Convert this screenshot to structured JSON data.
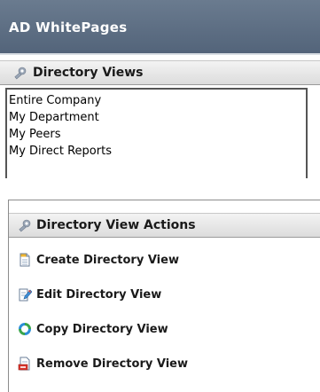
{
  "app": {
    "title": "AD WhitePages"
  },
  "directory_views": {
    "title": "Directory Views",
    "icon": "gear-icon",
    "items": [
      "Entire Company",
      "My Department",
      "My Peers",
      "My Direct Reports"
    ]
  },
  "directory_view_actions": {
    "title": "Directory View Actions",
    "icon": "gear-icon",
    "items": [
      {
        "label": "Create Directory View",
        "icon": "new-document-icon"
      },
      {
        "label": "Edit Directory View",
        "icon": "edit-document-icon"
      },
      {
        "label": "Copy Directory View",
        "icon": "copy-recycle-icon"
      },
      {
        "label": "Remove Directory View",
        "icon": "remove-document-icon"
      }
    ]
  },
  "colors": {
    "header_bg": "#5d6e84",
    "header_text": "#ffffff",
    "section_bg": "#e6e6e6"
  }
}
